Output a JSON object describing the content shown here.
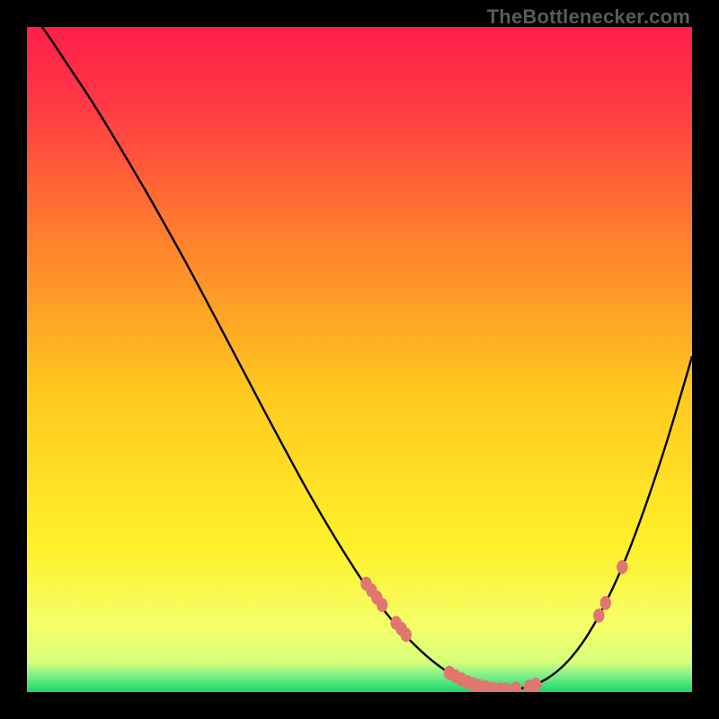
{
  "watermark": "TheBottlenecker.com",
  "colors": {
    "gradient_top": "#ff1f4b",
    "gradient_mid": "#ffd300",
    "gradient_bottom_yellow": "#f8ff67",
    "gradient_green": "#17d86b",
    "curve": "#000000",
    "marker": "#e0766f",
    "background": "#000000"
  },
  "chart_data": {
    "type": "line",
    "title": "",
    "xlabel": "",
    "ylabel": "",
    "xlim": [
      0,
      100
    ],
    "ylim": [
      0,
      100
    ],
    "curve": {
      "x": [
        0,
        3,
        6,
        9,
        12,
        15,
        18,
        21,
        24,
        27,
        30,
        33,
        36,
        39,
        42,
        45,
        48,
        51,
        54,
        57,
        60,
        63,
        66,
        69,
        72,
        75,
        78,
        81,
        84,
        87,
        90,
        93,
        96,
        99,
        100
      ],
      "y": [
        103,
        99,
        94.5,
        90,
        85.2,
        80.2,
        75.1,
        69.8,
        64.4,
        58.8,
        53.1,
        47.4,
        41.7,
        36.1,
        30.6,
        25.4,
        20.5,
        15.9,
        11.9,
        8.4,
        5.5,
        3.2,
        1.6,
        0.7,
        0.4,
        0.7,
        1.9,
        4.3,
        8.1,
        13.4,
        20.0,
        28.0,
        37.0,
        47.0,
        50.5
      ]
    },
    "markers": [
      {
        "x": 51.0,
        "y": 16.3
      },
      {
        "x": 51.8,
        "y": 15.3
      },
      {
        "x": 52.6,
        "y": 14.2
      },
      {
        "x": 53.4,
        "y": 13.1
      },
      {
        "x": 55.5,
        "y": 10.4
      },
      {
        "x": 56.3,
        "y": 9.5
      },
      {
        "x": 57.0,
        "y": 8.6
      },
      {
        "x": 63.5,
        "y": 2.9
      },
      {
        "x": 64.4,
        "y": 2.4
      },
      {
        "x": 65.3,
        "y": 1.9
      },
      {
        "x": 66.2,
        "y": 1.5
      },
      {
        "x": 67.1,
        "y": 1.2
      },
      {
        "x": 68.0,
        "y": 0.9
      },
      {
        "x": 69.0,
        "y": 0.7
      },
      {
        "x": 70.0,
        "y": 0.5
      },
      {
        "x": 71.0,
        "y": 0.4
      },
      {
        "x": 72.0,
        "y": 0.4
      },
      {
        "x": 73.5,
        "y": 0.5
      },
      {
        "x": 75.5,
        "y": 0.8
      },
      {
        "x": 76.5,
        "y": 1.1
      },
      {
        "x": 86.0,
        "y": 11.5
      },
      {
        "x": 87.0,
        "y": 13.4
      },
      {
        "x": 89.5,
        "y": 18.8
      }
    ],
    "flat_region_x": [
      68,
      76
    ]
  }
}
